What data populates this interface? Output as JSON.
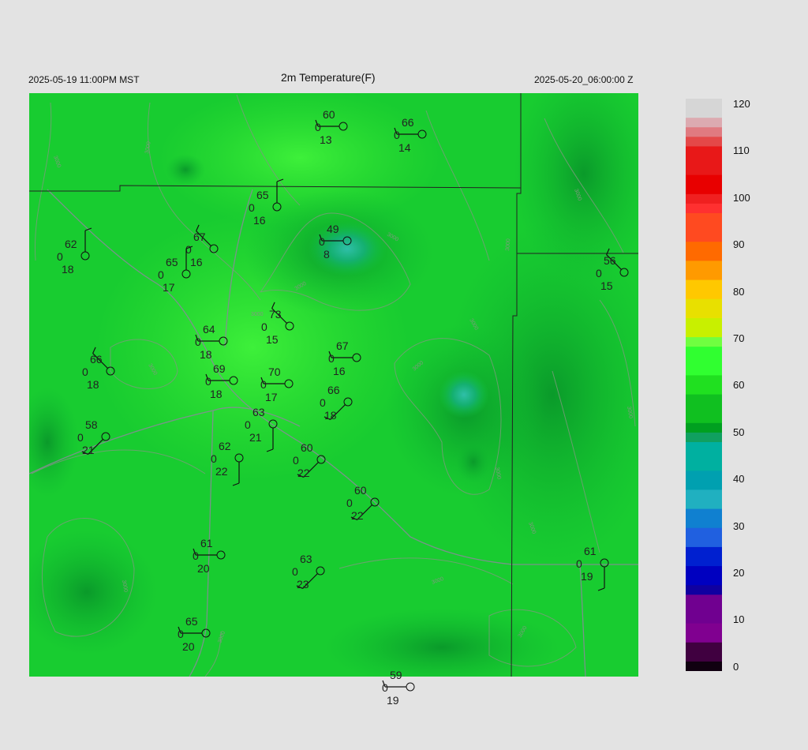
{
  "header": {
    "local_time": "2025-05-19 11:00PM MST",
    "title": "2m Temperature(F)",
    "valid_time": "2025-05-20_06:00:00 Z"
  },
  "colorbar": {
    "labels": [
      "120",
      "110",
      "100",
      "90",
      "80",
      "70",
      "60",
      "50",
      "40",
      "30",
      "20",
      "10",
      "0"
    ]
  },
  "contour_label": "3000",
  "stations": [
    {
      "temp": "60",
      "dew": "13",
      "cloud": "0"
    },
    {
      "temp": "66",
      "dew": "14",
      "cloud": "0"
    },
    {
      "temp": "65",
      "dew": "16",
      "cloud": "0"
    },
    {
      "temp": "49",
      "dew": "8",
      "cloud": "0"
    },
    {
      "temp": "62",
      "dew": "18",
      "cloud": "0"
    },
    {
      "temp": "67",
      "dew": "16",
      "cloud": "0"
    },
    {
      "temp": "65",
      "dew": "17",
      "cloud": "0"
    },
    {
      "temp": "56",
      "dew": "15",
      "cloud": "0"
    },
    {
      "temp": "73",
      "dew": "15",
      "cloud": "0"
    },
    {
      "temp": "64",
      "dew": "18",
      "cloud": "0"
    },
    {
      "temp": "67",
      "dew": "16",
      "cloud": "0"
    },
    {
      "temp": "66",
      "dew": "18",
      "cloud": "0"
    },
    {
      "temp": "69",
      "dew": "18",
      "cloud": "0"
    },
    {
      "temp": "70",
      "dew": "17",
      "cloud": "0"
    },
    {
      "temp": "66",
      "dew": "18",
      "cloud": "0"
    },
    {
      "temp": "58",
      "dew": "21",
      "cloud": "0"
    },
    {
      "temp": "63",
      "dew": "21",
      "cloud": "0"
    },
    {
      "temp": "62",
      "dew": "22",
      "cloud": "0"
    },
    {
      "temp": "60",
      "dew": "22",
      "cloud": "0"
    },
    {
      "temp": "60",
      "dew": "22",
      "cloud": "0"
    },
    {
      "temp": "61",
      "dew": "20",
      "cloud": "0"
    },
    {
      "temp": "63",
      "dew": "23",
      "cloud": "0"
    },
    {
      "temp": "61",
      "dew": "19",
      "cloud": "0"
    },
    {
      "temp": "65",
      "dew": "20",
      "cloud": "0"
    },
    {
      "temp": "59",
      "dew": "19",
      "cloud": "0"
    }
  ]
}
